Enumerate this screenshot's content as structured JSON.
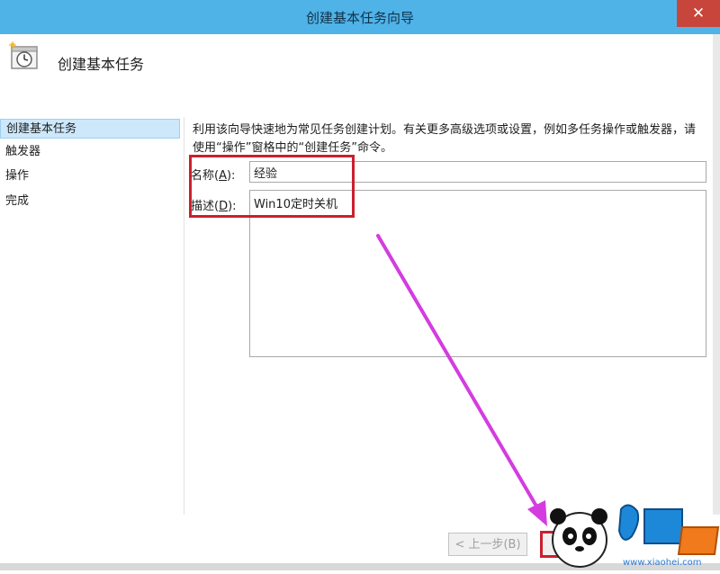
{
  "window": {
    "title": "创建基本任务向导",
    "close_symbol": "✕"
  },
  "header": {
    "heading": "创建基本任务",
    "icon": "task-clock-icon"
  },
  "sidebar": {
    "items": [
      {
        "label": "创建基本任务",
        "active": true
      },
      {
        "label": "触发器",
        "active": false
      },
      {
        "label": "操作",
        "active": false
      },
      {
        "label": "完成",
        "active": false
      }
    ]
  },
  "main": {
    "description": "利用该向导快速地为常见任务创建计划。有关更多高级选项或设置，例如多任务操作或触发器，请使用“操作”窗格中的“创建任务”命令。",
    "name_label_text": "名称(",
    "name_label_key": "A",
    "name_label_end": "):",
    "name_value": "经验",
    "desc_label_text": "描述(",
    "desc_label_key": "D",
    "desc_label_end": "):",
    "desc_value": "Win10定时关机"
  },
  "footer": {
    "back_label": "< 上一步(B)",
    "next_label": ""
  },
  "watermark": {
    "url": "www.xiaohei.com"
  },
  "colors": {
    "titlebar": "#4fb3e8",
    "highlight": "#cc1f2e",
    "arrow": "#d43ce0",
    "active_item": "#cde8fb"
  }
}
